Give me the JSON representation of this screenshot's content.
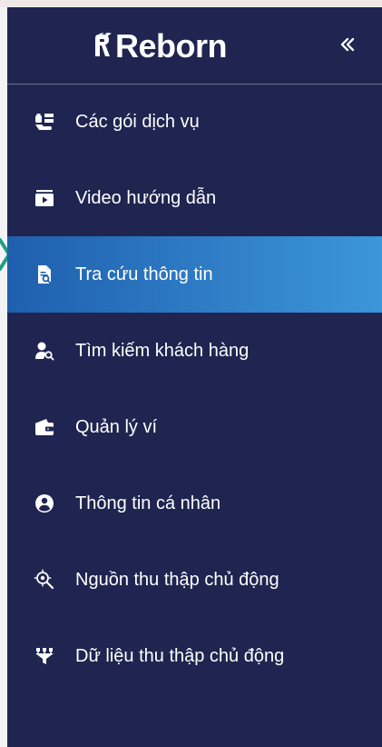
{
  "app": {
    "brand_name": "Reborn"
  },
  "sidebar": {
    "background_color": "#1f2550",
    "active_gradient": [
      "#1f5fae",
      "#3c96da"
    ],
    "collapse_icon": "double-chevron-left-icon",
    "items": [
      {
        "label": "Các gói dịch vụ",
        "icon": "service-package-icon",
        "active": false
      },
      {
        "label": "Video hướng dẫn",
        "icon": "video-tutorial-icon",
        "active": false
      },
      {
        "label": "Tra cứu thông tin",
        "icon": "document-search-icon",
        "active": true
      },
      {
        "label": "Tìm kiếm khách hàng",
        "icon": "customer-search-icon",
        "active": false
      },
      {
        "label": "Quản lý ví",
        "icon": "wallet-icon",
        "active": false
      },
      {
        "label": "Thông tin cá nhân",
        "icon": "user-profile-icon",
        "active": false
      },
      {
        "label": "Nguồn thu thập chủ động",
        "icon": "data-source-icon",
        "active": false
      },
      {
        "label": "Dữ liệu thu thập chủ động",
        "icon": "data-filter-icon",
        "active": false
      }
    ]
  }
}
